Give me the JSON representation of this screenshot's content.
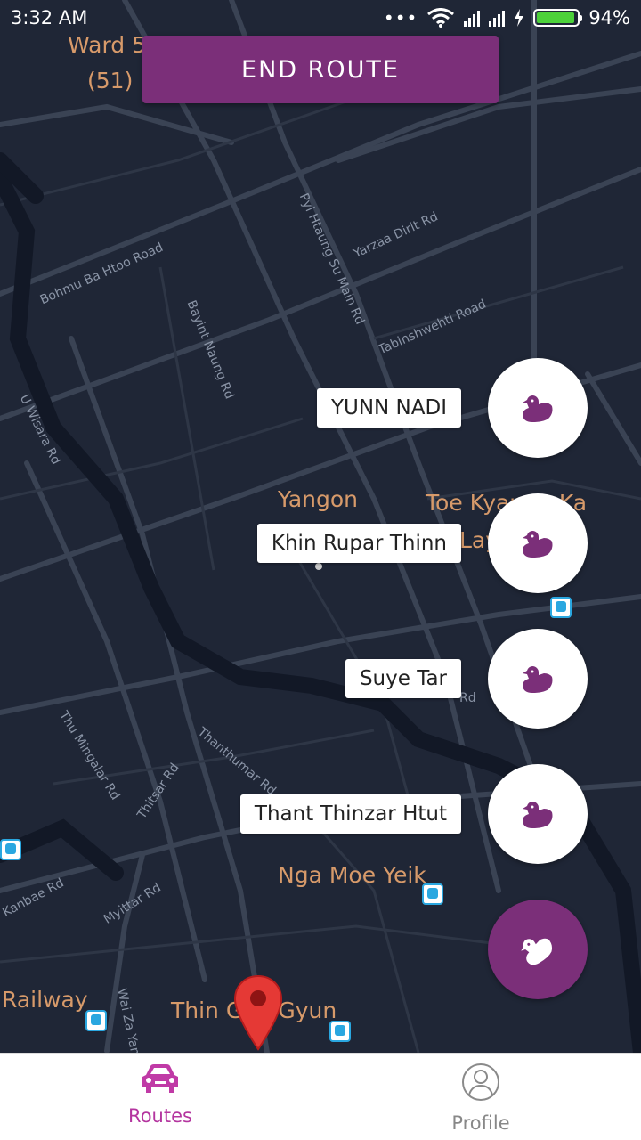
{
  "status_bar": {
    "time": "3:32 AM",
    "battery": "94%",
    "battery_level": 0.94
  },
  "top_button": {
    "label": "END ROUTE"
  },
  "map": {
    "place_labels": {
      "ward": "Ward 5",
      "ward_num": "(51)",
      "yangon": "Yangon",
      "toe_kyaung": "Toe Kyaung Ka",
      "toe_lay": "Lay",
      "nga_moe_yeik": "Nga Moe Yeik",
      "railway": "Railway",
      "thin_gan_gyun": "Thin Gan Gyun"
    },
    "road_labels": {
      "bohmu": "Bohmu Ba Htoo Road",
      "bayint": "Bayint Naung Rd",
      "pyi_htaung": "Pyi Htaung Su Main Rd",
      "yarzaa": "Yarzaa Dirit Rd",
      "tabinshwehti": "Tabinshwehti Road",
      "wisara": "U Wisara Rd",
      "thu_mingalar": "Thu Mingalar Rd",
      "thanthumar": "Thanthumar Rd",
      "thitsar": "Thitsar Rd",
      "kanbae": "Kanbae Rd",
      "myittar": "Myittar Rd",
      "waiza": "Wai Za Yan Ta",
      "rd_short": "Rd"
    }
  },
  "routes": [
    {
      "name": "YUNN NADI",
      "icon": "duck-icon"
    },
    {
      "name": "Khin Rupar Thinn",
      "icon": "duck-icon"
    },
    {
      "name": "Suye Tar",
      "icon": "duck-icon"
    },
    {
      "name": "Thant Thinzar Htut",
      "icon": "duck-icon"
    }
  ],
  "main_fab": {
    "icon": "duck-icon"
  },
  "bottom_nav": {
    "routes": {
      "label": "Routes",
      "icon": "car-icon"
    },
    "profile": {
      "label": "Profile",
      "icon": "profile-icon"
    }
  },
  "colors": {
    "accent": "#7b2f79",
    "active_tab": "#b4359f",
    "map_bg": "#1f2636"
  }
}
